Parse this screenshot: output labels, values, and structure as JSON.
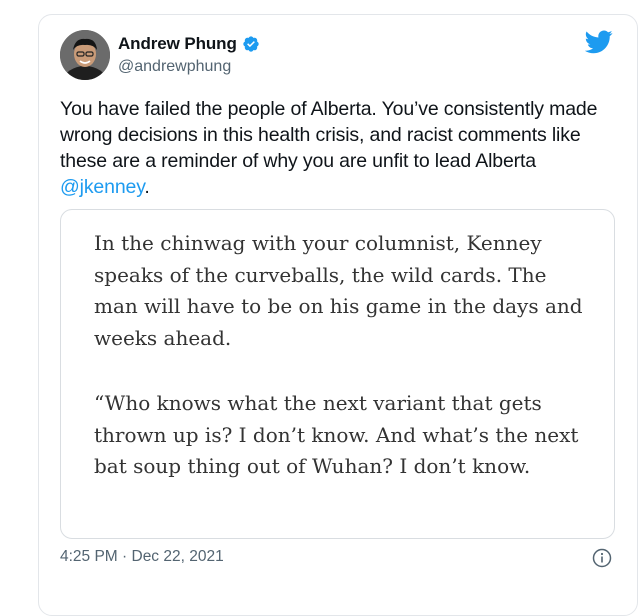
{
  "author": {
    "name": "Andrew Phung",
    "handle": "@andrewphung",
    "verified": true
  },
  "tweet": {
    "text": "You have failed the people of Alberta. You’ve consistently made wrong decisions in this health crisis, and racist comments like these are a reminder of why you are unfit to lead Alberta ",
    "mention": "@jkenney",
    "trailing": "."
  },
  "quote": {
    "paragraph1": "In the chinwag with your columnist, Kenney speaks of the curveballs, the wild cards. The man will have to be on his game in the days and weeks ahead.",
    "paragraph2": "“Who knows what the next variant that gets thrown up is? I don’t know. And what’s the next bat soup thing out of Wuhan? I don’t know."
  },
  "timestamp": "4:25 PM · Dec 22, 2021",
  "icons": {
    "logo": "twitter-bird-icon",
    "verified": "verified-badge-icon",
    "info": "info-icon"
  },
  "colors": {
    "accent": "#1d9bf0",
    "text": "#0f1419",
    "muted": "#536471"
  }
}
